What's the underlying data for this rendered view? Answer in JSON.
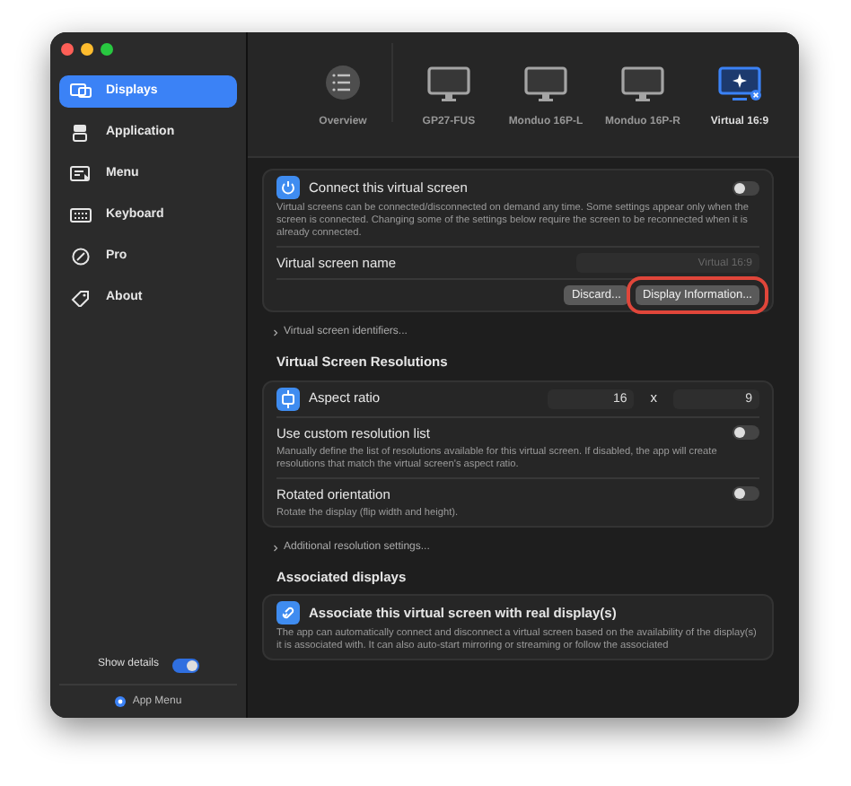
{
  "sidebar": {
    "items": [
      {
        "label": "Displays",
        "selected": true
      },
      {
        "label": "Application",
        "selected": false
      },
      {
        "label": "Menu",
        "selected": false
      },
      {
        "label": "Keyboard",
        "selected": false
      },
      {
        "label": "Pro",
        "selected": false
      },
      {
        "label": "About",
        "selected": false
      }
    ],
    "show_details": {
      "label": "Show details",
      "on": true
    },
    "footer": "App Menu"
  },
  "toolbar": [
    {
      "label": "Overview",
      "kind": "overview",
      "selected": false
    },
    {
      "label": "GP27-FUS",
      "kind": "display",
      "selected": false
    },
    {
      "label": "Monduo 16P-L",
      "kind": "display",
      "selected": false
    },
    {
      "label": "Monduo 16P-R",
      "kind": "display",
      "selected": false
    },
    {
      "label": "Virtual 16:9",
      "kind": "virtual",
      "selected": true
    }
  ],
  "panels": [
    {
      "kind": "card",
      "rows": [
        {
          "kind": "toggle",
          "label": "Connect this virtual screen",
          "on": false,
          "description": "Virtual screens can be connected/disconnected on demand any time. Some settings appear only when the screen is connected. Changing some of the settings below require the screen to be reconnected when it is already connected."
        },
        {
          "kind": "field",
          "label": "Virtual screen name",
          "placeholder": "Virtual 16:9"
        },
        {
          "kind": "buttons",
          "buttons": [
            {
              "label": "Discard...",
              "highlighted": false
            },
            {
              "label": "Display Information...",
              "highlighted": true
            }
          ]
        }
      ]
    },
    {
      "kind": "disclosure",
      "label": "Virtual screen identifiers..."
    },
    {
      "kind": "heading",
      "label": "Virtual Screen Resolutions"
    },
    {
      "kind": "card",
      "rows": [
        {
          "kind": "pair",
          "label": "Aspect ratio",
          "value_1": "16",
          "separator": "x",
          "value_2": "9"
        },
        {
          "kind": "toggle",
          "label": "Use custom resolution list",
          "on": false,
          "description": "Manually define the list of resolutions available for this virtual screen. If disabled, the app will create resolutions that match the virtual screen's aspect ratio."
        },
        {
          "kind": "toggle",
          "label": "Rotated orientation",
          "on": false,
          "description": "Rotate the display (flip width and height)."
        }
      ]
    },
    {
      "kind": "disclosure",
      "label": "Additional resolution settings..."
    },
    {
      "kind": "heading",
      "label": "Associated displays"
    },
    {
      "kind": "card",
      "rows": [
        {
          "kind": "title",
          "label": "Associate this virtual screen with real display(s)",
          "description": "The app can automatically connect and disconnect a virtual screen based on the availability of the display(s) it is associated with. It can also auto-start mirroring or streaming or follow the associated"
        }
      ]
    }
  ]
}
